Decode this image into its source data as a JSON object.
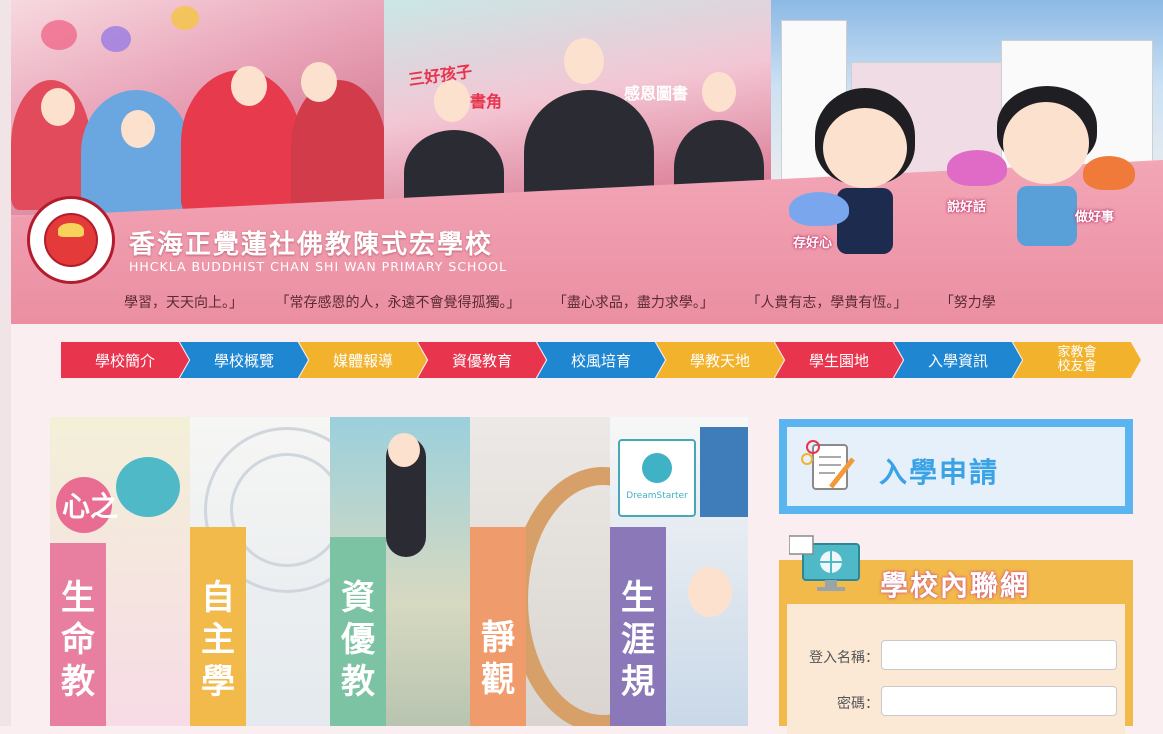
{
  "banner": {
    "school_name_zh": "香海正覺蓮社佛教陳式宏學校",
    "school_name_en": "HHCKLA BUDDHIST CHAN SHI WAN PRIMARY SCHOOL",
    "crest_text": "香海正覺蓮社佛教陳式宏學校",
    "sign_left": "三好孩子",
    "sign_left_2": "好書角",
    "sign_right": "感恩圖書",
    "cartoon_labels": [
      "存好心",
      "說好話",
      "做好事"
    ],
    "mottos": [
      "學習，天天向上。」",
      "「常存感恩的人，永遠不會覺得孤獨。」",
      "「盡心求品，盡力求學。」",
      "「人貴有志，學貴有恆。」",
      "「努力學"
    ]
  },
  "nav": {
    "items": [
      {
        "label": "學校簡介",
        "color": "#e8344d"
      },
      {
        "label": "學校概覽",
        "color": "#1f86d1"
      },
      {
        "label": "媒體報導",
        "color": "#f2b22c"
      },
      {
        "label": "資優教育",
        "color": "#e8344d"
      },
      {
        "label": "校風培育",
        "color": "#1f86d1"
      },
      {
        "label": "學教天地",
        "color": "#f2b22c"
      },
      {
        "label": "學生園地",
        "color": "#e8344d"
      },
      {
        "label": "入學資訊",
        "color": "#1f86d1"
      }
    ],
    "last_item": {
      "line1": "家教會",
      "line2": "校友會",
      "color": "#f2b22c"
    }
  },
  "mosaic": {
    "tiles": [
      {
        "label": "生命教",
        "extra": "心之",
        "bar_color": "#e97fa0"
      },
      {
        "label": "自主學",
        "bar_color": "#f2b94b"
      },
      {
        "label": "資優教",
        "bar_color": "#7cc3a4"
      },
      {
        "label": "靜觀",
        "bar_color": "#ef9b6b"
      },
      {
        "label": "生涯規",
        "bar_color": "#8a78b8",
        "logo_text": "DreamStarter"
      }
    ]
  },
  "apply": {
    "title": "入學申請"
  },
  "intranet": {
    "title": "學校內聯網",
    "username_label": "登入名稱：",
    "username_value": "",
    "password_label": "密碼：",
    "password_value": ""
  }
}
